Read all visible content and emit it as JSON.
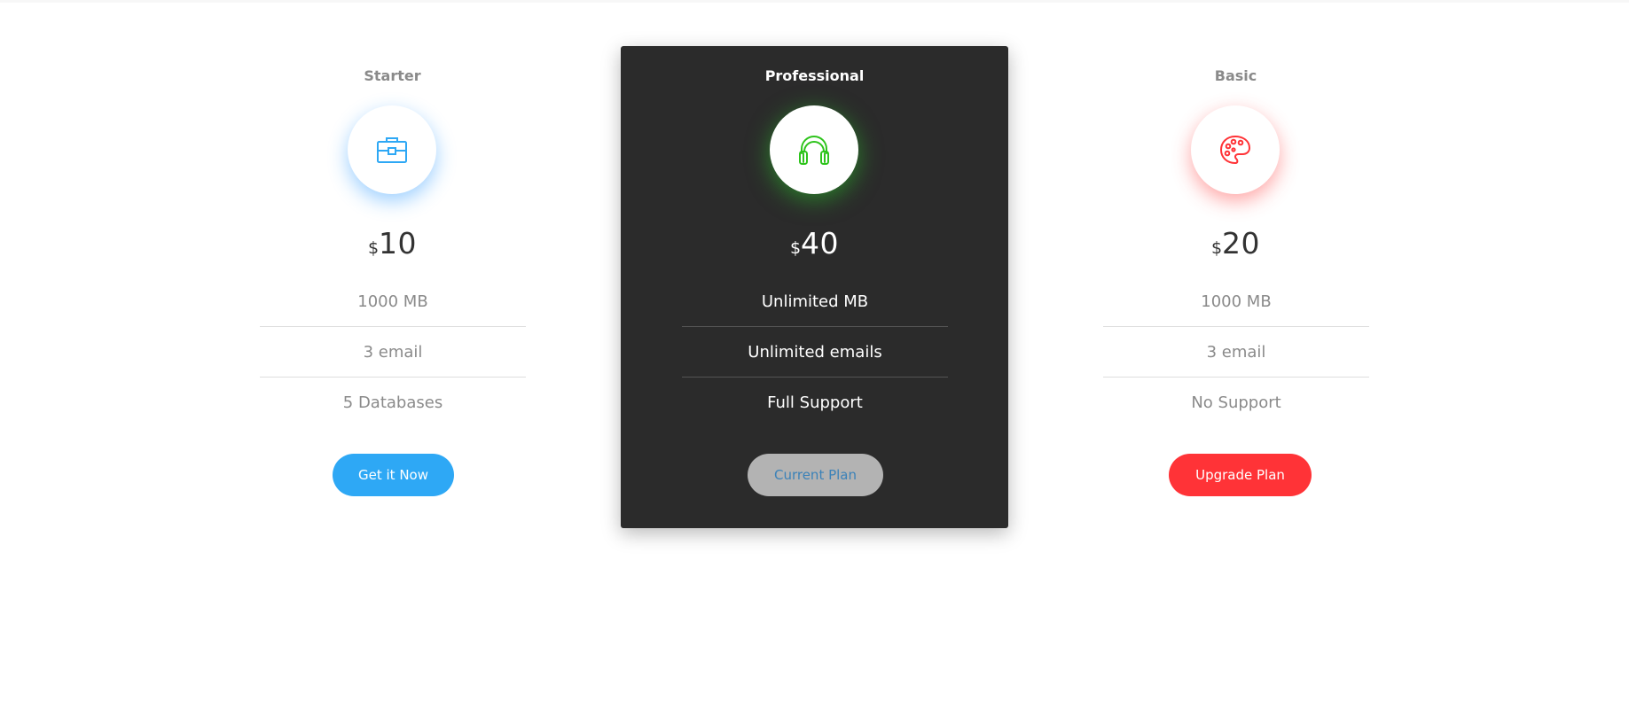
{
  "plans": [
    {
      "name": "Starter",
      "icon": "briefcase-icon",
      "icon_color": "#2ea8f5",
      "currency": "$",
      "price": "10",
      "features": [
        "1000 MB",
        "3 email",
        "5 Databases"
      ],
      "button_label": "Get it Now",
      "button_color": "#2ea8f5"
    },
    {
      "name": "Professional",
      "icon": "headphones-icon",
      "icon_color": "#2ec41c",
      "currency": "$",
      "price": "40",
      "features": [
        "Unlimited MB",
        "Unlimited emails",
        "Full Support"
      ],
      "button_label": "Current Plan",
      "button_color": "#b3b3b3",
      "highlighted": true
    },
    {
      "name": "Basic",
      "icon": "palette-icon",
      "icon_color": "#ff3337",
      "currency": "$",
      "price": "20",
      "features": [
        "1000 MB",
        "3 email",
        "No Support"
      ],
      "button_label": "Upgrade Plan",
      "button_color": "#ff3337"
    }
  ]
}
